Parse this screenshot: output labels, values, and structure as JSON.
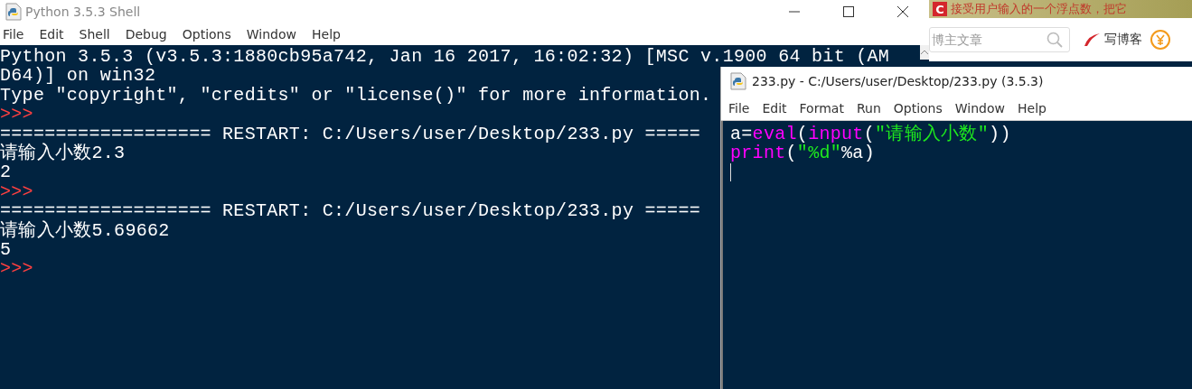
{
  "browser": {
    "logo": "C",
    "headline": "接受用户输入的一个浮点数，把它",
    "search": {
      "placeholder": "博主文章"
    },
    "write_link": "写博客"
  },
  "shell": {
    "title": "Python 3.5.3 Shell",
    "menu": [
      "File",
      "Edit",
      "Shell",
      "Debug",
      "Options",
      "Window",
      "Help"
    ],
    "lines": [
      {
        "kind": "output",
        "text": "Python 3.5.3 (v3.5.3:1880cb95a742, Jan 16 2017, 16:02:32) [MSC v.1900 64 bit (AM"
      },
      {
        "kind": "output",
        "text": "D64)] on win32"
      },
      {
        "kind": "output",
        "text": "Type \"copyright\", \"credits\" or \"license()\" for more information."
      },
      {
        "kind": "prompt",
        "text": ">>>"
      },
      {
        "kind": "output",
        "text": "=================== RESTART: C:/Users/user/Desktop/233.py ====="
      },
      {
        "kind": "output",
        "text": "请输入小数2.3"
      },
      {
        "kind": "output",
        "text": "2"
      },
      {
        "kind": "prompt",
        "text": ">>>"
      },
      {
        "kind": "output",
        "text": "=================== RESTART: C:/Users/user/Desktop/233.py ====="
      },
      {
        "kind": "output",
        "text": "请输入小数5.69662"
      },
      {
        "kind": "output",
        "text": "5"
      },
      {
        "kind": "prompt",
        "text": ">>>"
      }
    ]
  },
  "editor": {
    "title": "233.py - C:/Users/user/Desktop/233.py (3.5.3)",
    "menu": [
      "File",
      "Edit",
      "Format",
      "Run",
      "Options",
      "Window",
      "Help"
    ],
    "code": [
      [
        {
          "kind": "plain",
          "text": "a="
        },
        {
          "kind": "builtin",
          "text": "eval"
        },
        {
          "kind": "plain",
          "text": "("
        },
        {
          "kind": "builtin",
          "text": "input"
        },
        {
          "kind": "plain",
          "text": "("
        },
        {
          "kind": "string",
          "text": "\"请输入小数\""
        },
        {
          "kind": "plain",
          "text": "))"
        }
      ],
      [
        {
          "kind": "builtin",
          "text": "print"
        },
        {
          "kind": "plain",
          "text": "("
        },
        {
          "kind": "string",
          "text": "\"%d\""
        },
        {
          "kind": "plain",
          "text": "%a)"
        }
      ]
    ]
  }
}
